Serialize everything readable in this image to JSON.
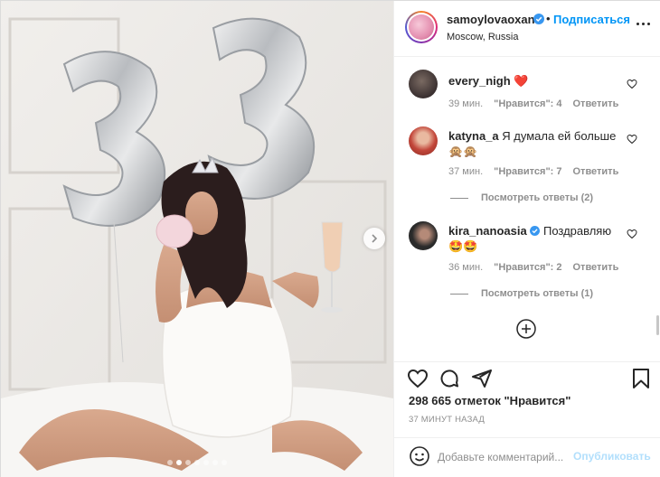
{
  "post": {
    "author": {
      "username": "samoylovaoxana",
      "verified": true,
      "follow_label": "Подписаться",
      "location": "Moscow, Russia"
    },
    "carousel": {
      "slide_count": 7,
      "active_index": 1
    },
    "comments": [
      {
        "username": "every_nigh",
        "text": "❤️",
        "time": "39 мин.",
        "likes_label": "\"Нравится\": 4",
        "reply_label": "Ответить",
        "avatar_color": "#3a3030"
      },
      {
        "username": "katyna_a",
        "text": "Я думала ей больше 🙊🙊",
        "time": "37 мин.",
        "likes_label": "\"Нравится\": 7",
        "reply_label": "Ответить",
        "view_replies": "Посмотреть ответы (2)",
        "avatar_color": "#c2463a"
      },
      {
        "username": "kira_nanoasia",
        "verified": true,
        "text": "Поздравляю",
        "emoji_line": "🤩🤩",
        "time": "36 мин.",
        "likes_label": "\"Нравится\": 2",
        "reply_label": "Ответить",
        "view_replies": "Посмотреть ответы (1)",
        "avatar_color": "#2a2a2a"
      }
    ],
    "likes": "298 665 отметок \"Нравится\"",
    "time_ago": "37 МИНУТ НАЗАД",
    "comment_box": {
      "placeholder": "Добавьте комментарий...",
      "publish_label": "Опубликовать"
    },
    "icons": [
      "heart-icon",
      "comment-icon",
      "share-icon",
      "bookmark-icon",
      "smile-icon",
      "more-icon",
      "chevron-right-icon",
      "add-circle-icon",
      "verified-icon"
    ],
    "colors": {
      "link_blue": "#0095f6",
      "publish_disabled": "#b2dffc",
      "like_red": "#ed4956",
      "muted": "#8e8e8e"
    }
  }
}
